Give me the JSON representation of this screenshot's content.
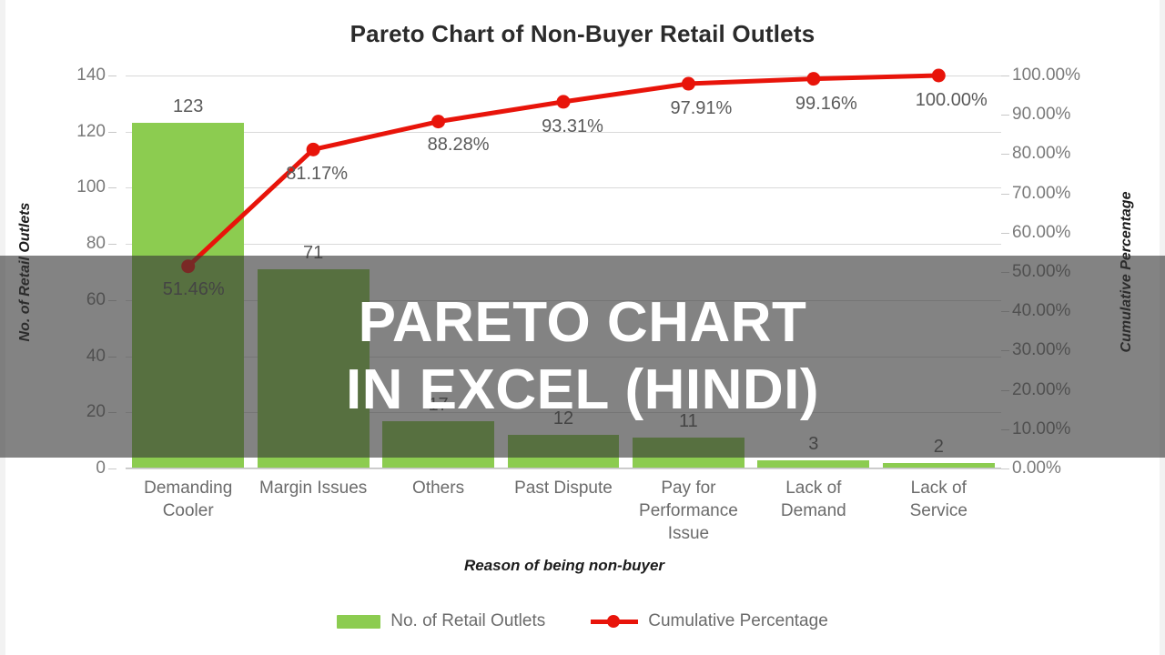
{
  "chart_data": {
    "type": "bar",
    "title": "Pareto Chart of Non-Buyer Retail Outlets",
    "xlabel": "Reason of being non-buyer",
    "ylabel": "No. of Retail Outlets",
    "y2label": "Cumulative Percentage",
    "categories": [
      "Demanding Cooler",
      "Margin Issues",
      "Others",
      "Past Dispute",
      "Pay for Performance Issue",
      "Lack of Demand",
      "Lack of Service"
    ],
    "category_lines": [
      [
        "Demanding",
        "Cooler"
      ],
      [
        "Margin Issues"
      ],
      [
        "Others"
      ],
      [
        "Past Dispute"
      ],
      [
        "Pay for",
        "Performance",
        "Issue"
      ],
      [
        "Lack of",
        "Demand"
      ],
      [
        "Lack of",
        "Service"
      ]
    ],
    "series": [
      {
        "name": "No. of Retail Outlets",
        "type": "bar",
        "color": "#8CCC50",
        "values": [
          123,
          71,
          17,
          12,
          11,
          3,
          2
        ],
        "labels": [
          "123",
          "71",
          "17",
          "12",
          "11",
          "3",
          "2"
        ]
      },
      {
        "name": "Cumulative Percentage",
        "type": "line",
        "color": "#E8140A",
        "values": [
          51.46,
          81.17,
          88.28,
          93.31,
          97.91,
          99.16,
          100.0
        ],
        "labels": [
          "51.46%",
          "81.17%",
          "88.28%",
          "93.31%",
          "97.91%",
          "99.16%",
          "100.00%"
        ]
      }
    ],
    "ylim": [
      0,
      140
    ],
    "y2lim": [
      0,
      100
    ],
    "yticks": [
      "0",
      "20",
      "40",
      "60",
      "80",
      "100",
      "120",
      "140"
    ],
    "ytick_values": [
      0,
      20,
      40,
      60,
      80,
      100,
      120,
      140
    ],
    "y2ticks": [
      "0.00%",
      "10.00%",
      "20.00%",
      "30.00%",
      "40.00%",
      "50.00%",
      "60.00%",
      "70.00%",
      "80.00%",
      "90.00%",
      "100.00%"
    ],
    "y2tick_values": [
      0,
      10,
      20,
      30,
      40,
      50,
      60,
      70,
      80,
      90,
      100
    ],
    "grid": true,
    "legend_position": "bottom",
    "legend": [
      "No. of Retail Outlets",
      "Cumulative Percentage"
    ]
  },
  "overlay": {
    "line1": "PARETO CHART",
    "line2": "IN EXCEL (HINDI)",
    "band_color": "#373737",
    "text_color": "#FFFFFF"
  }
}
